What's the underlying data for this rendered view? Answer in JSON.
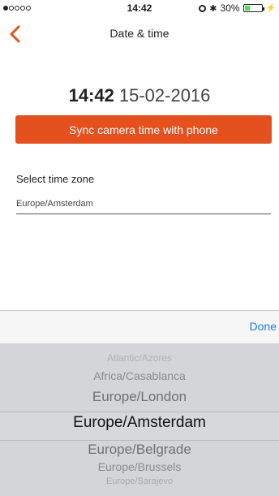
{
  "status_bar": {
    "time": "14:42",
    "battery": "30%",
    "battery_level": 0.3
  },
  "nav": {
    "title": "Date & time"
  },
  "datetime": {
    "time": "14:42",
    "date": "15-02-2016"
  },
  "sync_button_label": "Sync camera time with phone",
  "timezone": {
    "label": "Select time zone",
    "value": "Europe/Amsterdam"
  },
  "toolbar": {
    "done_label": "Done"
  },
  "picker": {
    "items": [
      "Atlantic/Azores",
      "Africa/Casablanca",
      "Europe/London",
      "Europe/Amsterdam",
      "Europe/Belgrade",
      "Europe/Brussels",
      "Europe/Sarajevo"
    ],
    "selected": "Europe/Amsterdam"
  },
  "colors": {
    "accent": "#e5501f",
    "link": "#1a7fd8",
    "picker_bg": "#d3d5d9"
  }
}
